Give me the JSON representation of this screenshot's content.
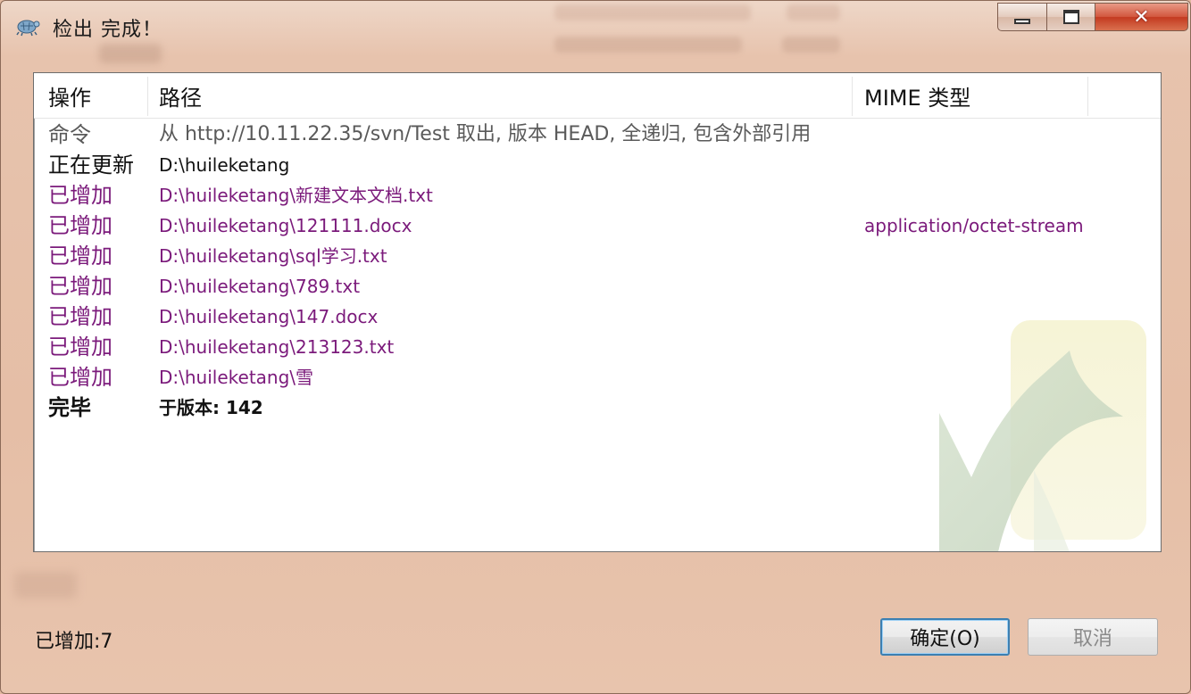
{
  "window": {
    "title": "检出 完成！",
    "close_glyph": "✕"
  },
  "columns": {
    "action": "操作",
    "path": "路径",
    "mime": "MIME 类型"
  },
  "rows": [
    {
      "action": "命令",
      "path": "从 http://10.11.22.35/svn/Test 取出, 版本 HEAD, 全递归, 包含外部引用",
      "mime": ""
    },
    {
      "action": "正在更新",
      "path": "D:\\huileketang",
      "mime": ""
    },
    {
      "action": "已增加",
      "path": "D:\\huileketang\\新建文本文档.txt",
      "mime": ""
    },
    {
      "action": "已增加",
      "path": "D:\\huileketang\\121111.docx",
      "mime": "application/octet-stream"
    },
    {
      "action": "已增加",
      "path": "D:\\huileketang\\sql学习.txt",
      "mime": ""
    },
    {
      "action": "已增加",
      "path": "D:\\huileketang\\789.txt",
      "mime": ""
    },
    {
      "action": "已增加",
      "path": "D:\\huileketang\\147.docx",
      "mime": ""
    },
    {
      "action": "已增加",
      "path": "D:\\huileketang\\213123.txt",
      "mime": ""
    },
    {
      "action": "已增加",
      "path": "D:\\huileketang\\雪",
      "mime": ""
    },
    {
      "action": "完毕",
      "path": "于版本: 142",
      "mime": ""
    }
  ],
  "status": {
    "added_count": "已增加:7"
  },
  "buttons": {
    "ok": "确定(O)",
    "cancel": "取消"
  },
  "colors": {
    "added": "#7b1a7b",
    "command": "#5a5a5a",
    "window_frame": "#e5bea6"
  },
  "icons": {
    "app": "tortoise-icon",
    "watermark": "checkmark-watermark-icon"
  }
}
